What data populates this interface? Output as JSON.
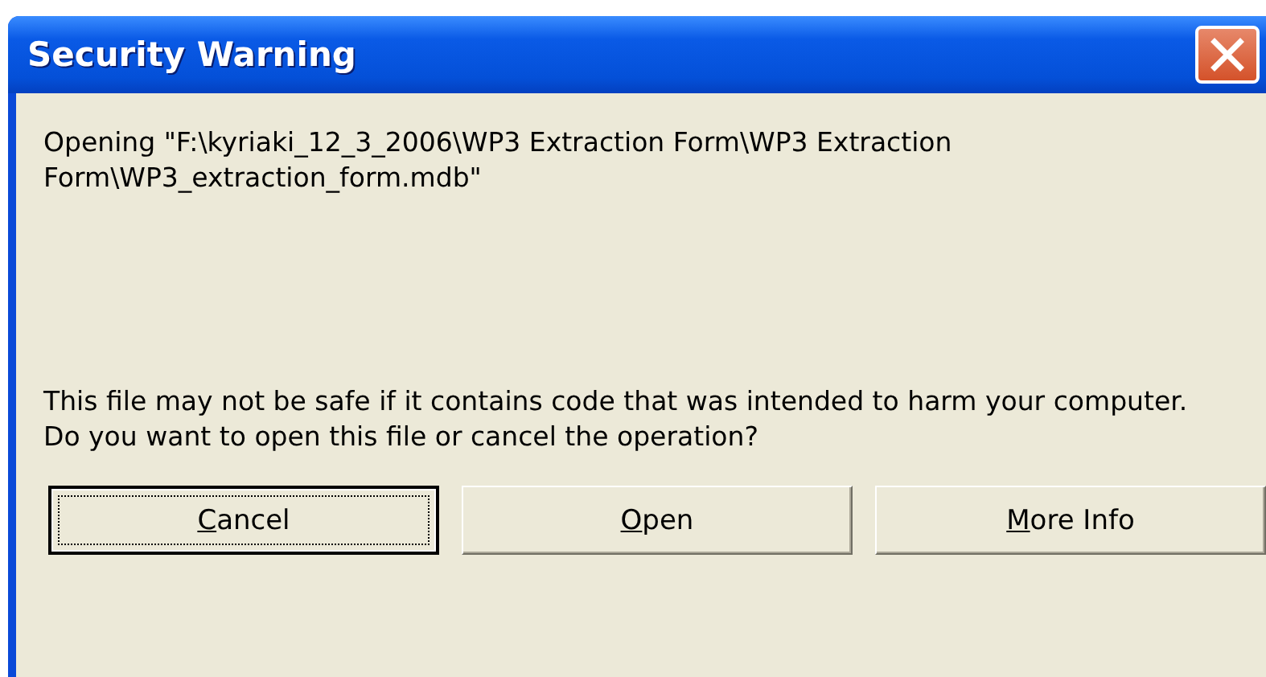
{
  "window": {
    "title": "Security Warning"
  },
  "message": {
    "path_line": "Opening \"F:\\kyriaki_12_3_2006\\WP3 Extraction Form\\WP3 Extraction Form\\WP3_extraction_form.mdb\"",
    "warning": "This file may not be safe if it contains code that was intended to harm your computer.",
    "question": "Do you want to open this file or cancel the operation?"
  },
  "buttons": [
    {
      "label": "Cancel",
      "default": true,
      "underline_first": true
    },
    {
      "label": "Open",
      "default": false,
      "underline_first": true
    },
    {
      "label": "More Info",
      "default": false,
      "underline_first": true
    }
  ]
}
